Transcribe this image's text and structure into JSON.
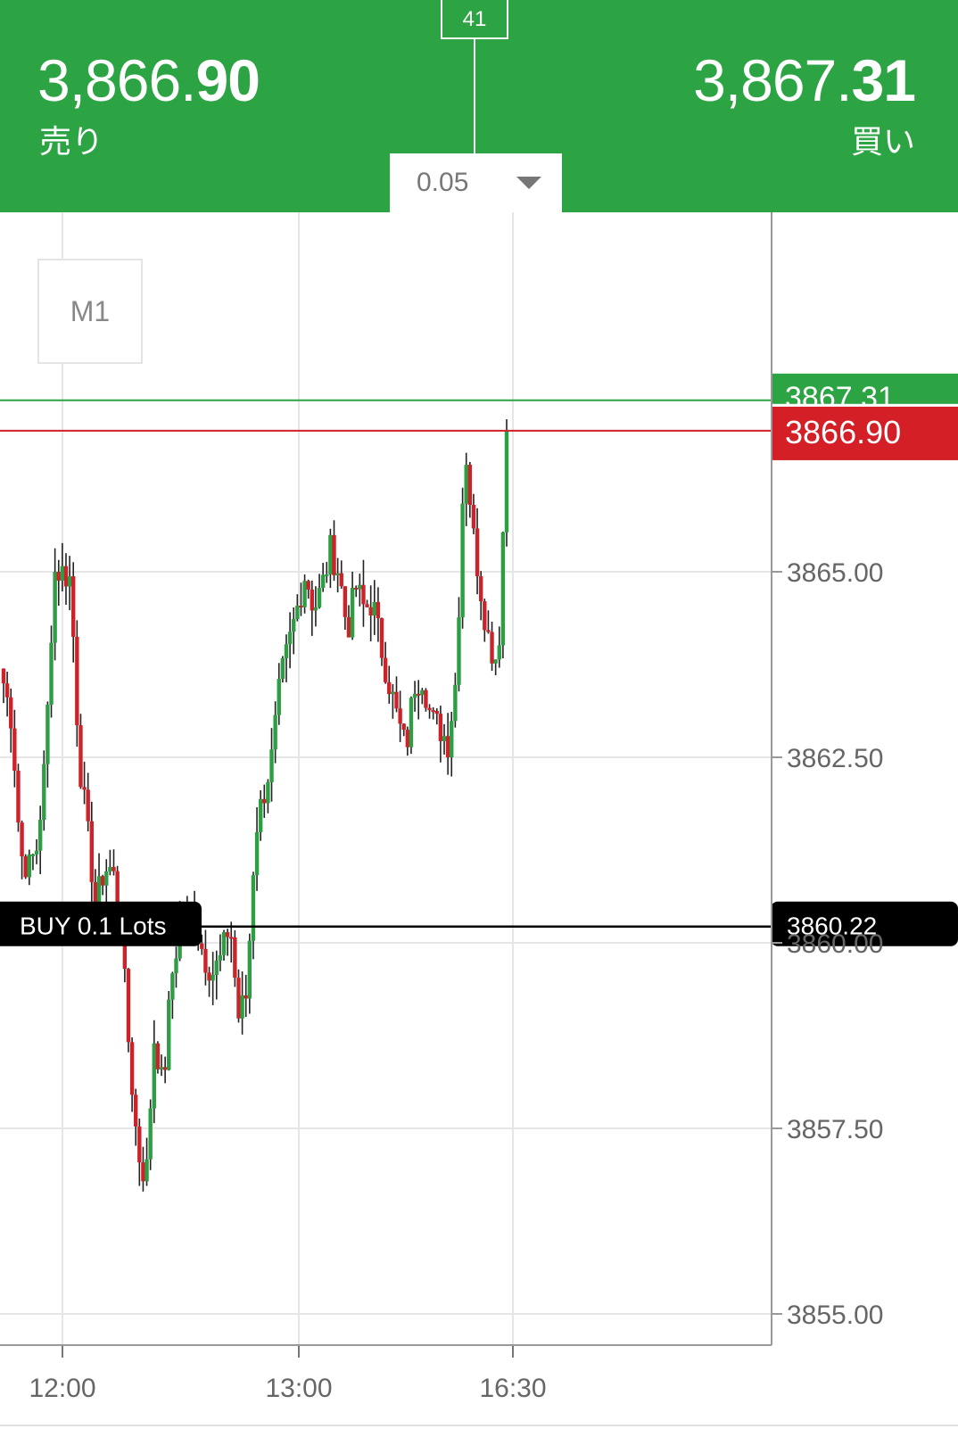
{
  "header": {
    "sell_price_main": "3,866.",
    "sell_price_big": "90",
    "sell_label": "売り",
    "buy_price_main": "3,867.",
    "buy_price_big": "31",
    "buy_label": "買い",
    "spread": "41",
    "lot_size": "0.05"
  },
  "timeframe": "M1",
  "colors": {
    "up": "#2e9e45",
    "down": "#cc2229",
    "accent_green": "#2ca444",
    "accent_red": "#d41f27"
  },
  "chart_data": {
    "type": "candlestick",
    "y_range": [
      3854.3,
      3871.5
    ],
    "y_ticks": [
      {
        "value": 3865.0,
        "label": "3865.00"
      },
      {
        "value": 3862.5,
        "label": "3862.50"
      },
      {
        "value": 3860.0,
        "label": "3860.00"
      },
      {
        "value": 3857.5,
        "label": "3857.50"
      },
      {
        "value": 3855.0,
        "label": "3855.00"
      }
    ],
    "x_ticks": [
      "12:00",
      "13:00",
      "16:30"
    ],
    "ask_line": {
      "value": 3867.31,
      "label": "3867.31"
    },
    "bid_line": {
      "value": 3866.9,
      "label": "3866.90"
    },
    "position_line": {
      "value": 3860.22,
      "label": "3860.22",
      "tag": "BUY 0.1 Lots"
    },
    "candle_count": 138,
    "candle_path": [
      3863.5,
      3863.0,
      3861.2,
      3861.0,
      3861.3,
      3862.5,
      3865.0,
      3865.0,
      3864.9,
      3862.5,
      3861.5,
      3860.5,
      3861.0,
      3861.0,
      3860.2,
      3858.5,
      3857.2,
      3856.8,
      3858.8,
      3858.0,
      3859.5,
      3860.2,
      3860.4,
      3860.2,
      3859.8,
      3859.6,
      3859.8,
      3860.3,
      3859.0,
      3859.3,
      3861.5,
      3862.0,
      3862.5,
      3863.5,
      3864.0,
      3864.5,
      3865.0,
      3864.5,
      3864.8,
      3865.3,
      3865.0,
      3864.2,
      3864.8,
      3864.5,
      3864.6,
      3864.0,
      3863.5,
      3863.0,
      3862.6,
      3863.5,
      3863.6,
      3863.0,
      3862.9,
      3862.7,
      3863.6,
      3866.8,
      3865.5,
      3864.7,
      3864.0,
      3863.8,
      3866.9
    ]
  },
  "footer_icons": []
}
